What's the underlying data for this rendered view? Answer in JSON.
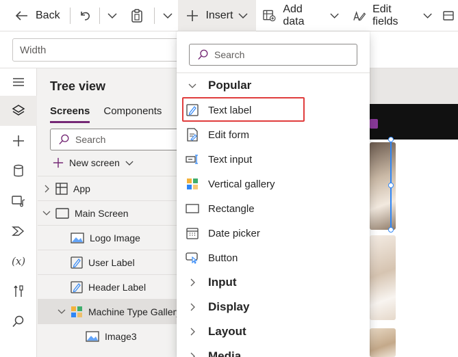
{
  "commandbar": {
    "back_label": "Back",
    "insert_label": "Insert",
    "add_data_label": "Add data",
    "edit_fields_label": "Edit fields"
  },
  "formula": {
    "property": "Width"
  },
  "tree": {
    "title": "Tree view",
    "tabs": [
      "Screens",
      "Components"
    ],
    "search_placeholder": "Search",
    "new_screen_label": "New screen",
    "nodes": [
      "App",
      "Main Screen",
      "Logo Image",
      "User Label",
      "Header Label",
      "Machine Type Gallery",
      "Image3"
    ]
  },
  "insert_menu": {
    "search_placeholder": "Search",
    "sections": [
      "Popular",
      "Input",
      "Display",
      "Layout",
      "Media"
    ],
    "popular_items": [
      "Text label",
      "Edit form",
      "Text input",
      "Vertical gallery",
      "Rectangle",
      "Date picker",
      "Button"
    ]
  },
  "colors": {
    "accent": "#742774",
    "highlight": "#e03c3c",
    "selection": "#2f86f6"
  }
}
